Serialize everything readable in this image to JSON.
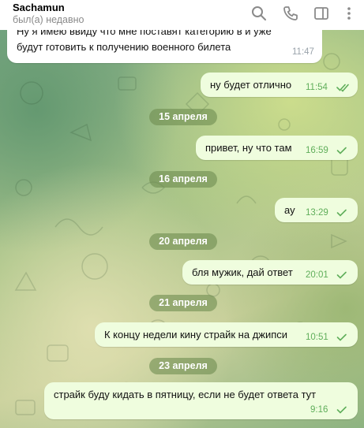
{
  "header": {
    "chat_name": "Sachamun",
    "status": "был(а) недавно",
    "icons": [
      "search-icon",
      "phone-icon",
      "sidebar-icon",
      "more-vertical-icon"
    ]
  },
  "messages": [
    {
      "direction": "in",
      "lines": [
        "Ну я имею ввиду что мне поставят категорию в и уже",
        "будут готовить к получению военного билета"
      ],
      "time": "11:47"
    },
    {
      "direction": "out",
      "text": "ну будет отлично",
      "time": "11:54",
      "status": "read"
    },
    {
      "direction": "out",
      "text": "привет, ну что там",
      "time": "16:59",
      "status": "sent"
    },
    {
      "direction": "out",
      "text": "ау",
      "time": "13:29",
      "status": "sent"
    },
    {
      "direction": "out",
      "text": "бля мужик, дай ответ",
      "time": "20:01",
      "status": "sent"
    },
    {
      "direction": "out",
      "text": "К концу недели кину страйк на джипси",
      "time": "10:51",
      "status": "sent"
    },
    {
      "direction": "out",
      "text": "страйк буду кидать в пятницу, если не будет ответа тут",
      "time": "9:16",
      "status": "sent"
    }
  ],
  "dates": [
    "15 апреля",
    "16 апреля",
    "20 апреля",
    "21 апреля",
    "23 апреля"
  ],
  "colors": {
    "outgoing_bubble": "#effdde",
    "incoming_bubble": "#ffffff",
    "check_green": "#5fae5a",
    "date_pill": "#6e8c50"
  }
}
